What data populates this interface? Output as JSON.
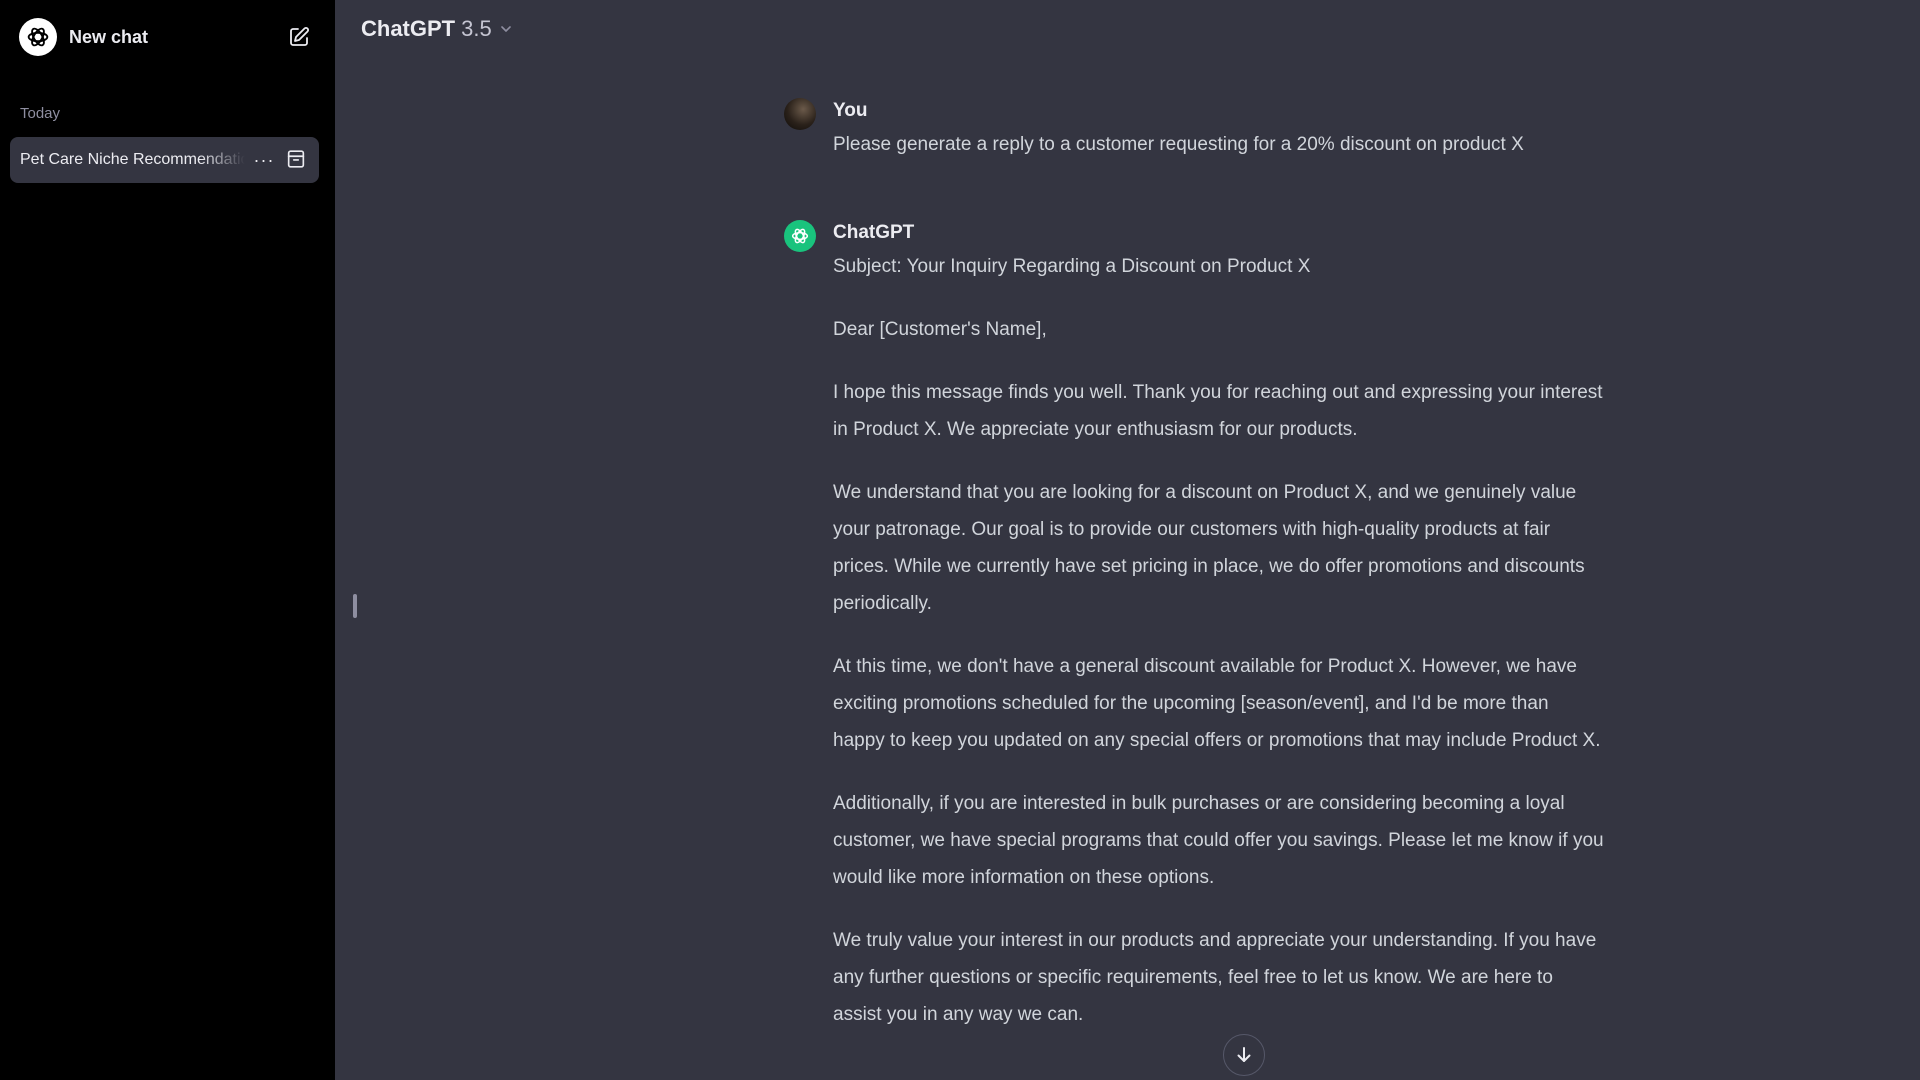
{
  "sidebar": {
    "new_chat_label": "New chat",
    "section_label": "Today",
    "history": [
      {
        "label": "Pet Care Niche Recommendations"
      }
    ],
    "dots_glyph": "···"
  },
  "header": {
    "model_name": "ChatGPT",
    "model_version": "3.5"
  },
  "conversation": {
    "user": {
      "author": "You",
      "text": "Please generate a reply to a customer requesting for a 20% discount on product X"
    },
    "assistant": {
      "author": "ChatGPT",
      "paragraphs": [
        "Subject: Your Inquiry Regarding a Discount on Product X",
        "Dear [Customer's Name],",
        "I hope this message finds you well. Thank you for reaching out and expressing your interest in Product X. We appreciate your enthusiasm for our products.",
        "We understand that you are looking for a discount on Product X, and we genuinely value your patronage. Our goal is to provide our customers with high-quality products at fair prices. While we currently have set pricing in place, we do offer promotions and discounts periodically.",
        "At this time, we don't have a general discount available for Product X. However, we have exciting promotions scheduled for the upcoming [season/event], and I'd be more than happy to keep you updated on any special offers or promotions that may include Product X.",
        "Additionally, if you are interested in bulk purchases or are considering becoming a loyal customer, we have special programs that could offer you savings. Please let me know if you would like more information on these options.",
        "We truly value your interest in our products and appreciate your understanding. If you have any further questions or specific requirements, feel free to let us know. We are here to assist you in any way we can."
      ]
    }
  },
  "colors": {
    "sidebar_bg": "#000000",
    "main_bg": "#343541",
    "accent_green": "#19c37d"
  }
}
